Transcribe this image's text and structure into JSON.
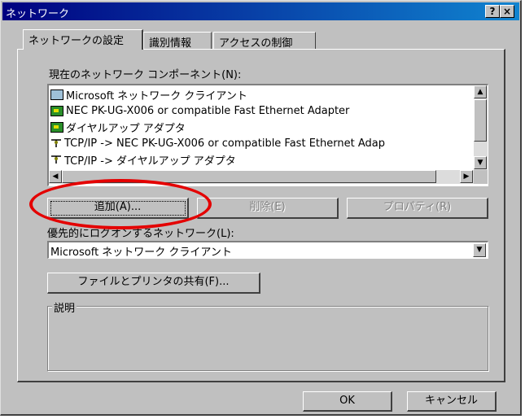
{
  "window": {
    "title": "ネットワーク",
    "help_button": "?",
    "close_button": "×"
  },
  "tabs": [
    {
      "label": "ネットワークの設定"
    },
    {
      "label": "識別情報"
    },
    {
      "label": "アクセスの制御"
    }
  ],
  "components": {
    "label": "現在のネットワーク コンポーネント(N):",
    "items": [
      {
        "icon": "network-client-icon",
        "text": "Microsoft ネットワーク クライアント"
      },
      {
        "icon": "network-card-icon",
        "text": "NEC PK-UG-X006 or compatible Fast Ethernet Adapter"
      },
      {
        "icon": "network-card-icon",
        "text": "ダイヤルアップ アダプタ"
      },
      {
        "icon": "protocol-icon",
        "text": "TCP/IP -> NEC PK-UG-X006 or compatible Fast Ethernet Adap"
      },
      {
        "icon": "protocol-icon",
        "text": "TCP/IP -> ダイヤルアップ アダプタ"
      }
    ]
  },
  "buttons": {
    "add": "追加(A)...",
    "remove": "削除(E)",
    "properties": "プロパティ(R)",
    "file_print_sharing": "ファイルとプリンタの共有(F)...",
    "ok": "OK",
    "cancel": "キャンセル"
  },
  "primary_logon": {
    "label": "優先的にログオンするネットワーク(L):",
    "value": "Microsoft ネットワーク クライアント"
  },
  "description": {
    "label": "説明"
  },
  "colors": {
    "highlight_circle": "#e40000",
    "title_bar": "#000080"
  }
}
